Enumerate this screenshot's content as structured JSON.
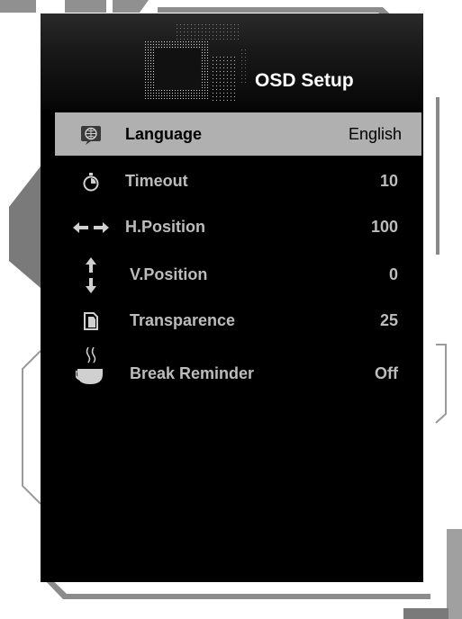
{
  "header": {
    "title": "OSD Setup"
  },
  "menu": {
    "items": [
      {
        "icon": "language-icon",
        "label": "Language",
        "value": "English",
        "selected": true
      },
      {
        "icon": "timeout-icon",
        "label": "Timeout",
        "value": "10",
        "selected": false
      },
      {
        "icon": "horizontal-arrows-icon",
        "label": "H.Position",
        "value": "100",
        "selected": false
      },
      {
        "icon": "vertical-arrows-icon",
        "label": "V.Position",
        "value": "0",
        "selected": false
      },
      {
        "icon": "transparence-icon",
        "label": "Transparence",
        "value": "25",
        "selected": false
      },
      {
        "icon": "coffee-cup-icon",
        "label": "Break Reminder",
        "value": "Off",
        "selected": false
      }
    ]
  },
  "colors": {
    "panel_background": "#000000",
    "selected_row": "#b0b0b0",
    "item_text": "#bcbcbc",
    "decor_gray": "#7a7a7a"
  }
}
